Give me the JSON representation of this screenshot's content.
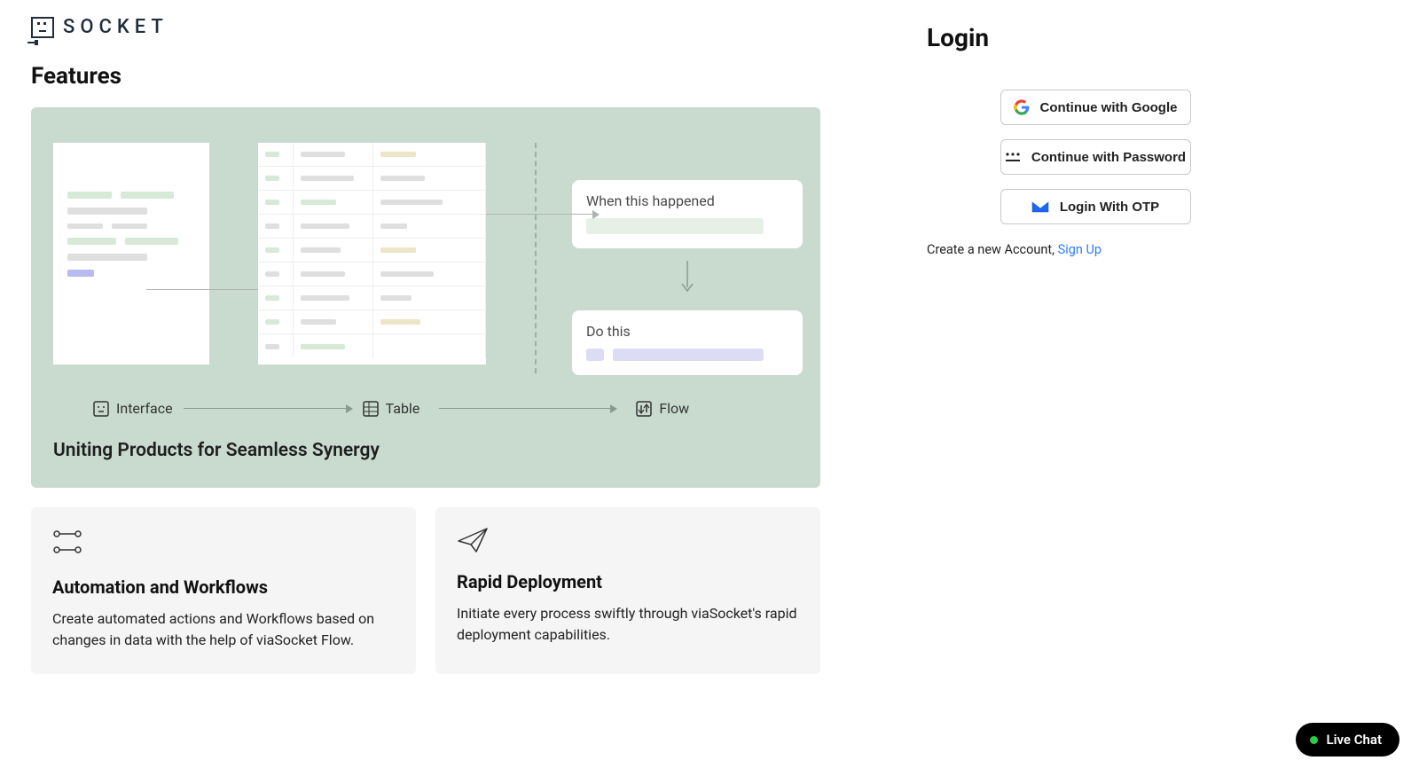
{
  "brand": {
    "name": "SOCKET"
  },
  "features": {
    "heading": "Features",
    "hero": {
      "flow_when": "When this happened",
      "flow_do": "Do this",
      "label_interface": "Interface",
      "label_table": "Table",
      "label_flow": "Flow",
      "caption": "Uniting Products for Seamless Synergy"
    },
    "tiles": [
      {
        "title": "Automation and Workflows",
        "desc": "Create automated actions and Workflows based on changes in data with the help of viaSocket Flow."
      },
      {
        "title": "Rapid Deployment",
        "desc": "Initiate every process swiftly through viaSocket's rapid deployment capabilities."
      }
    ]
  },
  "login": {
    "heading": "Login",
    "google": "Continue with Google",
    "password": "Continue with Password",
    "otp": "Login With OTP",
    "create_text": "Create a new Account, ",
    "signup": "Sign Up"
  },
  "chat": {
    "label": "Live Chat"
  }
}
